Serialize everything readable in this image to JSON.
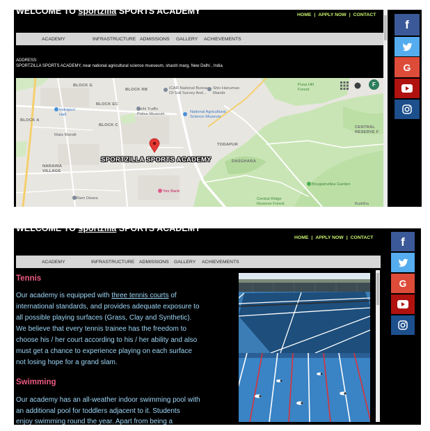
{
  "site": {
    "title_prefix": "WELCOME TO",
    "brand": "sportzilla",
    "title_suffix": "SPORTS ACADEMY"
  },
  "top_links": {
    "home": "HOME",
    "apply": "APPLY NOW",
    "contact": "CONTACT",
    "separator": "|"
  },
  "nav": [
    "ACADEMY",
    "INFRASTRUCTURE",
    "ADMISSIONS",
    "GALLERY",
    "ACHIEVEMENTS"
  ],
  "address": {
    "label": "ADDRESS:",
    "text": "SPORTZILLA SPORTS ACADEMY, near national agricultural science mueseum, shastri marg, New Delhi , India"
  },
  "map": {
    "marker_label": "SPORTZILLA SPORTS ACADEMY",
    "avatar": "F",
    "labels": [
      "BLOCK G",
      "BLOCK RB",
      "ICAR National Bureau Of Soil Survey And...",
      "Shiv Hanuman Mandir",
      "Pusa Hill Forest",
      "BLOCK EC",
      "Indrapuri Hall",
      "Delhi Traffic Police Museum",
      "National Agricultural Science Museum",
      "BLOCK A",
      "BLOCK C",
      "Mata Mandir",
      "CENTRAL RESERVE F",
      "TODAPUR",
      "DASGHARA",
      "NARAINA VILLAGE",
      "Yes Bank",
      "Bougainvillea Garden",
      "Ram Dwara",
      "Central Ridge Reserve Forest",
      "Buddha"
    ]
  },
  "social": [
    {
      "id": "facebook-icon",
      "color": "#3b5998",
      "glyph": "f"
    },
    {
      "id": "twitter-icon",
      "color": "#55acee"
    },
    {
      "id": "google-icon",
      "color": "#dd4b39",
      "glyph": "G"
    },
    {
      "id": "youtube-icon",
      "color": "#b0120f"
    },
    {
      "id": "instagram-icon",
      "color": "#1c4f8c"
    }
  ],
  "content": {
    "tennis": {
      "heading": "Tennis",
      "line1_before": "Our academy is equipped with ",
      "link": "three tennis courts",
      "line1_after": " of",
      "lines": [
        "international standards, and provides adequate exposure to",
        "all possible playing surfaces (Grass, Clay and Synthetic).",
        "We believe that every tennis trainee has the freedom to",
        "choose his / her court according to his / her ability and also",
        "must get a chance to experience playing on each surface",
        "not losing hope for a grand slam."
      ]
    },
    "swimming": {
      "heading": "Swimming",
      "lines": [
        "Our academy has an all-weather indoor swimming pool with",
        "an additional pool for toddlers adjacent to it. Students",
        "enjoy swimming round the year. Apart from being a"
      ]
    }
  },
  "theme": {
    "heading": "#ec5a80",
    "body_text": "#9ed7f7",
    "top_links": "#c9f36d",
    "menu_bar": "#d7d7d7"
  }
}
